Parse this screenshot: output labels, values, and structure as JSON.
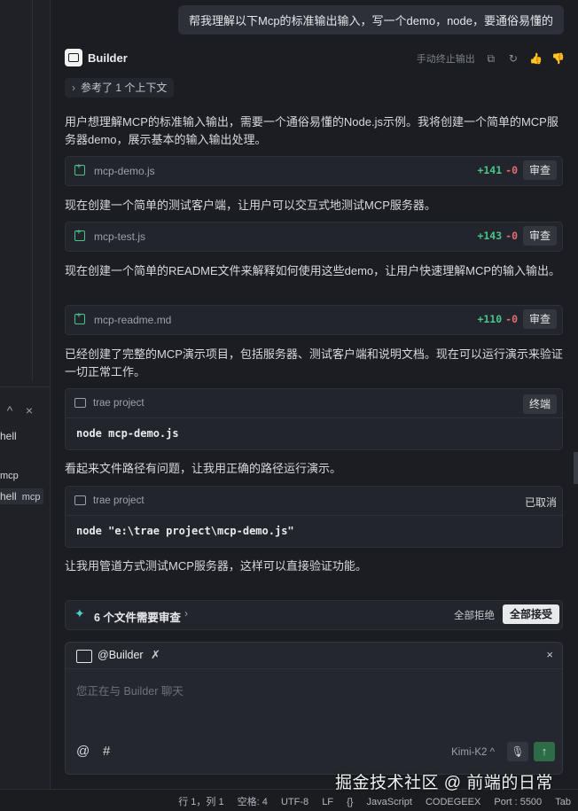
{
  "left_terminal": {
    "controls": [
      "^",
      "×"
    ],
    "items": [
      {
        "label": "hell",
        "tag": ""
      },
      {
        "label": "mcp",
        "tag": ""
      },
      {
        "label": "hell",
        "tag": "mcp"
      }
    ]
  },
  "user_message": "帮我理解以下Mcp的标准输出输入，写一个demo，node，要通俗易懂的",
  "bot": {
    "name": "Builder",
    "stop_label": "手动终止输出",
    "icons": [
      "copy-icon",
      "refresh-icon",
      "thumbs-up-icon",
      "thumbs-down-icon"
    ]
  },
  "context_ref": "参考了 1 个上下文",
  "paragraphs": [
    "用户想理解MCP的标准输入输出，需要一个通俗易懂的Node.js示例。我将创建一个简单的MCP服务器demo，展示基本的输入输出处理。",
    "现在创建一个简单的测试客户端，让用户可以交互式地测试MCP服务器。",
    "现在创建一个简单的README文件来解释如何使用这些demo，让用户快速理解MCP的输入输出。",
    "已经创建了完整的MCP演示项目，包括服务器、测试客户端和说明文档。现在可以运行演示来验证一切正常工作。",
    "看起来文件路径有问题，让我用正确的路径运行演示。",
    "让我用管道方式测试MCP服务器，这样可以直接验证功能。"
  ],
  "files": [
    {
      "name": "mcp-demo.js",
      "added": "+141",
      "removed": "-0",
      "action": "审查"
    },
    {
      "name": "mcp-test.js",
      "added": "+143",
      "removed": "-0",
      "action": "审查"
    },
    {
      "name": "mcp-readme.md",
      "added": "+110",
      "removed": "-0",
      "action": "审查"
    }
  ],
  "terminals": [
    {
      "title": "trae project",
      "button": "终端",
      "status": "",
      "command": "node mcp-demo.js"
    },
    {
      "title": "trae project",
      "button": "",
      "status": "已取消",
      "command": "node \"e:\\trae project\\mcp-demo.js\""
    }
  ],
  "pending_review": {
    "text": "6 个文件需要审查",
    "reject_all": "全部拒绝",
    "accept_all": "全部接受"
  },
  "composer": {
    "agent": "@Builder",
    "placeholder": "您正在与 Builder 聊天",
    "at": "@",
    "hash": "#",
    "model": "Kimi-K2 ^"
  },
  "status_bar": {
    "position": "行 1，列 1",
    "spaces": "空格: 4",
    "encoding": "UTF-8",
    "eol": "LF",
    "braces": "{}",
    "language": "JavaScript",
    "codegeex": "CODEGEEX",
    "port": "Port : 5500",
    "tab": "Tab"
  },
  "watermark": "掘金技术社区 @ 前端的日常"
}
